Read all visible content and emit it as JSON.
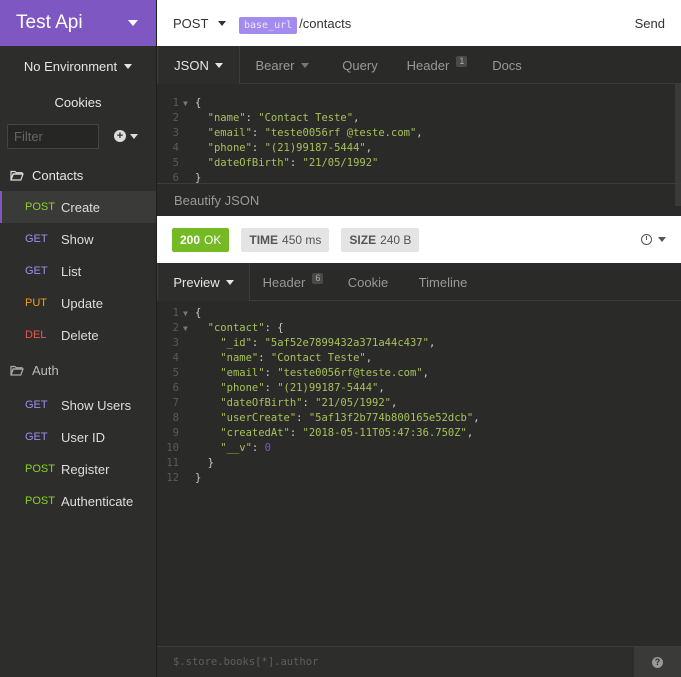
{
  "workspace": {
    "title": "Test Api"
  },
  "sidebar": {
    "environment": "No Environment",
    "cookies": "Cookies",
    "filter_placeholder": "Filter",
    "groups": [
      {
        "name": "Contacts",
        "items": [
          {
            "method": "POST",
            "label": "Create"
          },
          {
            "method": "GET",
            "label": "Show"
          },
          {
            "method": "GET",
            "label": "List"
          },
          {
            "method": "PUT",
            "label": "Update"
          },
          {
            "method": "DEL",
            "label": "Delete"
          }
        ]
      },
      {
        "name": "Auth",
        "items": [
          {
            "method": "GET",
            "label": "Show Users"
          },
          {
            "method": "GET",
            "label": "User ID"
          },
          {
            "method": "POST",
            "label": "Register"
          },
          {
            "method": "POST",
            "label": "Authenticate"
          }
        ]
      }
    ]
  },
  "urlbar": {
    "method": "POST",
    "tag": "base_url",
    "path": "/contacts",
    "send": "Send"
  },
  "request_tabs": {
    "json": "JSON",
    "bearer": "Bearer",
    "query": "Query",
    "header": "Header",
    "header_count": "1",
    "docs": "Docs"
  },
  "request_body": {
    "line1": "{",
    "k_name": "\"name\"",
    "v_name": "\"Contact Teste\"",
    "k_email": "\"email\"",
    "v_email": "\"teste0056rf @teste.com\"",
    "k_phone": "\"phone\"",
    "v_phone": "\"(21)99187-5444\"",
    "k_dob": "\"dateOfBirth\"",
    "v_dob": "\"21/05/1992\"",
    "line6": "}"
  },
  "beautify": "Beautify JSON",
  "status": {
    "code": "200",
    "text": "OK",
    "time_label": "TIME",
    "time_value": "450 ms",
    "size_label": "SIZE",
    "size_value": "240 B"
  },
  "response_tabs": {
    "preview": "Preview",
    "header": "Header",
    "header_count": "6",
    "cookie": "Cookie",
    "timeline": "Timeline"
  },
  "response_body": {
    "k_contact": "\"contact\"",
    "k_id": "\"_id\"",
    "v_id": "\"5af52e7899432a371a44c437\"",
    "k_name": "\"name\"",
    "v_name": "\"Contact Teste\"",
    "k_email": "\"email\"",
    "v_email": "\"teste0056rf@teste.com\"",
    "k_phone": "\"phone\"",
    "v_phone": "\"(21)99187-5444\"",
    "k_dob": "\"dateOfBirth\"",
    "v_dob": "\"21/05/1992\"",
    "k_user": "\"userCreate\"",
    "v_user": "\"5af13f2b774b800165e52dcb\"",
    "k_created": "\"createdAt\"",
    "v_created": "\"2018-05-11T05:47:36.750Z\"",
    "k_v": "\"__v\"",
    "v_v": "0"
  },
  "footer": {
    "filter_placeholder": "$.store.books[*].author"
  },
  "colors": {
    "accent": "#7e57c2",
    "post": "#8bd12c",
    "get": "#a48bf0",
    "put": "#f59a16",
    "delete": "#ef5350",
    "ok": "#75ba24"
  }
}
